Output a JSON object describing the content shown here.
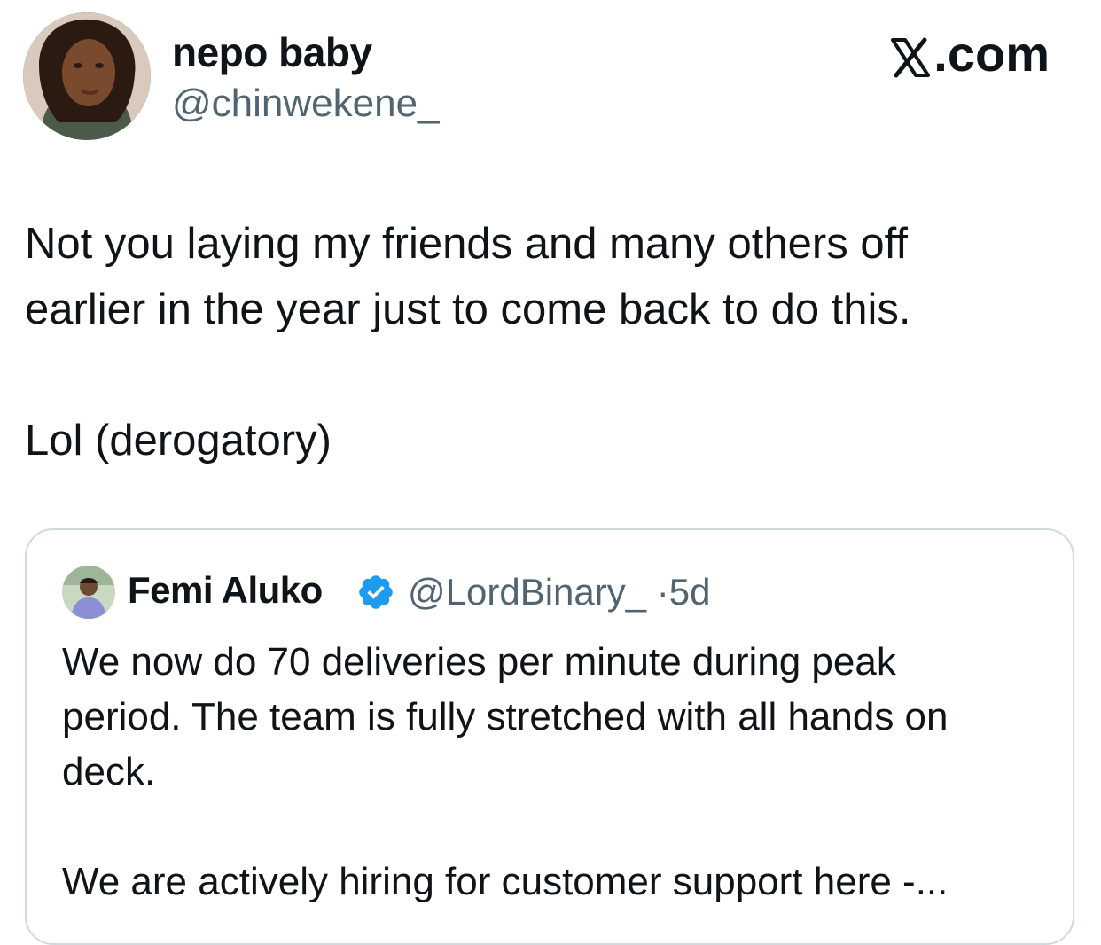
{
  "tweet": {
    "author": {
      "display_name": "nepo baby",
      "handle": "@chinwekene_"
    },
    "text_lines": [
      "Not you laying my friends and many others off",
      "earlier in the year just to come back to do this."
    ],
    "text_line_2": "Lol (derogatory)"
  },
  "brand": {
    "label": ".com",
    "icon": "x-logo-icon"
  },
  "quoted_tweet": {
    "author": {
      "display_name": "Femi Aluko",
      "verified": true,
      "handle": "@LordBinary_",
      "separator": "·",
      "time": "5d"
    },
    "text_lines": [
      "We now do 70 deliveries per minute during peak",
      "period. The team is fully stretched with all hands on",
      "deck."
    ],
    "text_line_last": "We are actively hiring for customer support here -..."
  },
  "colors": {
    "text_primary": "#0f1419",
    "text_secondary": "#536471",
    "border": "#cfd9de",
    "verified_blue": "#1d9bf0"
  }
}
